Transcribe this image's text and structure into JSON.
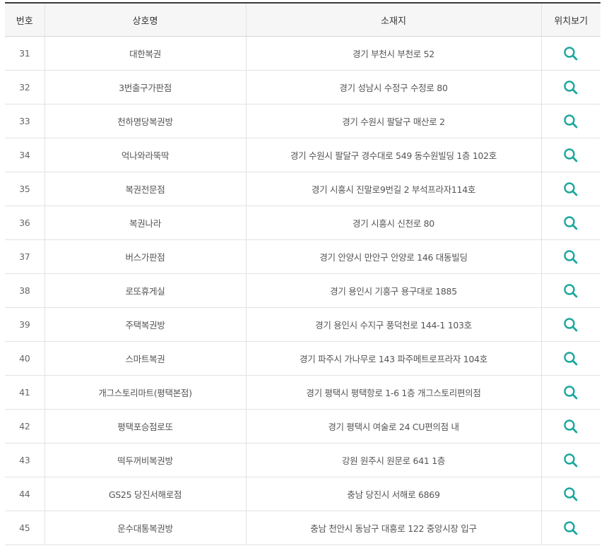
{
  "header": {
    "no": "번호",
    "name": "상호명",
    "address": "소재지",
    "location": "위치보기"
  },
  "accent_color": "#1aa79c",
  "location_icon": "search-icon",
  "rows": [
    {
      "no": "31",
      "name": "대한복권",
      "address": "경기 부천시 부천로 52"
    },
    {
      "no": "32",
      "name": "3번출구가판점",
      "address": "경기 성남시 수정구 수정로 80"
    },
    {
      "no": "33",
      "name": "천하명당복권방",
      "address": "경기 수원시 팔달구 매산로 2"
    },
    {
      "no": "34",
      "name": "억나와라뚝딱",
      "address": "경기 수원시 팔달구 경수대로 549 동수원빌딩 1층 102호"
    },
    {
      "no": "35",
      "name": "복권전문점",
      "address": "경기 시흥시 진말로9번길 2 부석프라자114호"
    },
    {
      "no": "36",
      "name": "복권나라",
      "address": "경기 시흥시 신천로 80"
    },
    {
      "no": "37",
      "name": "버스가판점",
      "address": "경기 안양시 만안구 안양로 146 대동빌딩"
    },
    {
      "no": "38",
      "name": "로또휴게실",
      "address": "경기 용인시 기흥구 용구대로 1885"
    },
    {
      "no": "39",
      "name": "주택복권방",
      "address": "경기 용인시 수지구 풍덕천로 144-1 103호"
    },
    {
      "no": "40",
      "name": "스마트복권",
      "address": "경기 파주시 가나무로 143 파주메트로프라자 104호"
    },
    {
      "no": "41",
      "name": "개그스토리마트(평택본점)",
      "address": "경기 평택시 평택항로 1-6 1층 개그스토리편의점"
    },
    {
      "no": "42",
      "name": "평택포승점로또",
      "address": "경기 평택시 여술로 24 CU편의점 내"
    },
    {
      "no": "43",
      "name": "떡두꺼비복권방",
      "address": "강원 원주시 원문로 641 1층"
    },
    {
      "no": "44",
      "name": "GS25 당진서해로점",
      "address": "충남 당진시 서해로 6869"
    },
    {
      "no": "45",
      "name": "운수대통복권방",
      "address": "충남 천안시 동남구 대흥로 122 중앙시장 입구"
    }
  ]
}
